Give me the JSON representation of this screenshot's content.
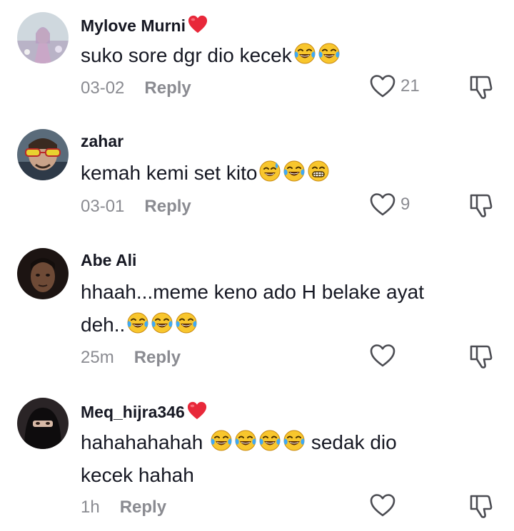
{
  "comments": [
    {
      "username": "Mylove Murni",
      "text": "suko sore dgr dio kecek",
      "time": "03-02",
      "reply_label": "Reply",
      "likes": "21"
    },
    {
      "username": "zahar",
      "text": "kemah kemi set kito",
      "time": "03-01",
      "reply_label": "Reply",
      "likes": "9"
    },
    {
      "username": "Abe Ali",
      "text_line1": "hhaah...meme keno ado H belake ayat",
      "text_line2": "deh..",
      "time": "25m",
      "reply_label": "Reply"
    },
    {
      "username": "Meq_hijra346",
      "text_a": "hahahahahah ",
      "text_b": " sedak dio",
      "text_line2": "kecek hahah",
      "time": "1h",
      "reply_label": "Reply"
    }
  ],
  "icons": {
    "like": "heart-outline-icon",
    "dislike": "thumbs-down-icon",
    "emoji_laugh": "face-with-tears-of-joy-emoji",
    "emoji_sweat": "grinning-face-with-sweat-emoji",
    "emoji_grin": "grimacing-grin-emoji",
    "heart": "red-heart-icon"
  },
  "colors": {
    "text": "#161823",
    "muted": "#8a8b91",
    "heart": "#e8283a"
  }
}
